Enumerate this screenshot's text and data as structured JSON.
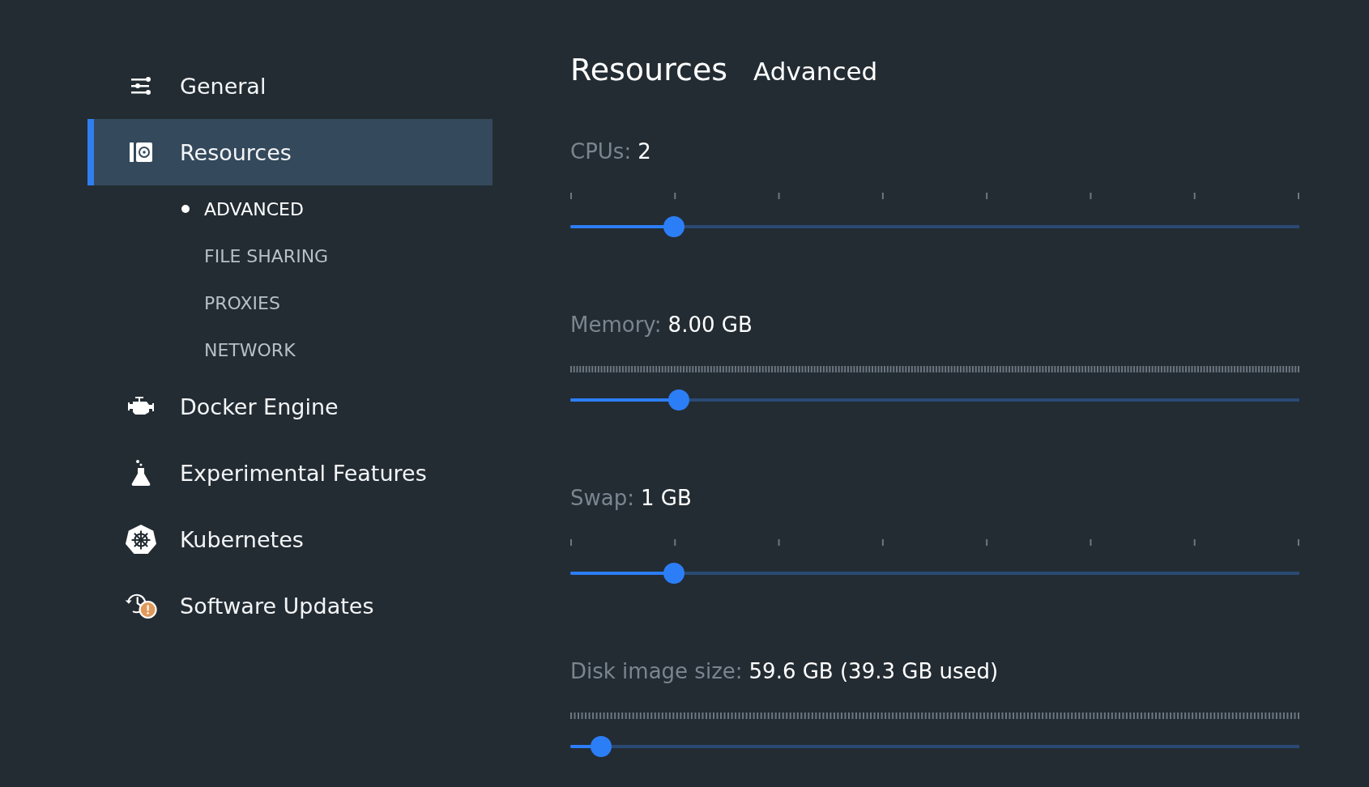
{
  "sidebar": {
    "items": [
      {
        "kind": "sliders",
        "label": "General",
        "selected": false
      },
      {
        "kind": "disk",
        "label": "Resources",
        "selected": true,
        "children": [
          {
            "label": "ADVANCED",
            "selected": true
          },
          {
            "label": "FILE SHARING",
            "selected": false
          },
          {
            "label": "PROXIES",
            "selected": false
          },
          {
            "label": "NETWORK",
            "selected": false
          }
        ]
      },
      {
        "kind": "engine",
        "label": "Docker Engine",
        "selected": false
      },
      {
        "kind": "flask",
        "label": "Experimental Features",
        "selected": false
      },
      {
        "kind": "wheel",
        "label": "Kubernetes",
        "selected": false
      },
      {
        "kind": "updates",
        "label": "Software Updates",
        "selected": false,
        "alert": true
      }
    ]
  },
  "header": {
    "tabs": [
      {
        "label": "Resources",
        "selected": true
      },
      {
        "label": "Advanced",
        "selected": false
      }
    ]
  },
  "settings": [
    {
      "kind": "coarse",
      "label": "CPUs:",
      "value": "2",
      "level": 0.1425
    },
    {
      "kind": "fine",
      "label": "Memory:",
      "value": "8.00 GB",
      "level": 0.149
    },
    {
      "kind": "coarse",
      "label": "Swap:",
      "value": "1 GB",
      "level": 0.1425
    },
    {
      "kind": "finer",
      "label": "Disk image size:",
      "value": "59.6 GB (39.3 GB used)",
      "level": 0.042
    }
  ]
}
